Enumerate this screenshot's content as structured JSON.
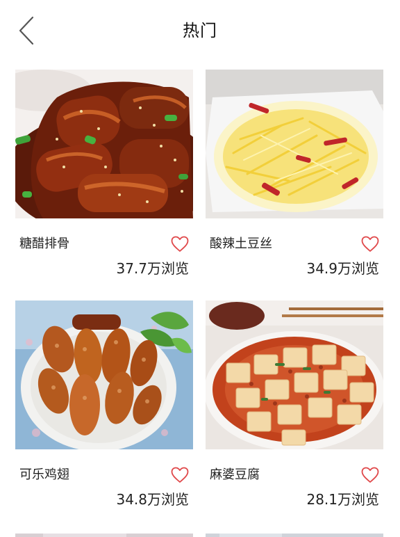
{
  "header": {
    "title": "热门"
  },
  "recipes": [
    {
      "name": "糖醋排骨",
      "views": "37.7万浏览"
    },
    {
      "name": "酸辣土豆丝",
      "views": "34.9万浏览"
    },
    {
      "name": "可乐鸡翅",
      "views": "34.8万浏览"
    },
    {
      "name": "麻婆豆腐",
      "views": "28.1万浏览"
    }
  ],
  "icons": {
    "back": "chevron-left-icon",
    "like": "heart-outline-icon"
  },
  "colors": {
    "accent": "#e0484a",
    "back_arrow": "#555555",
    "text": "#222222"
  }
}
